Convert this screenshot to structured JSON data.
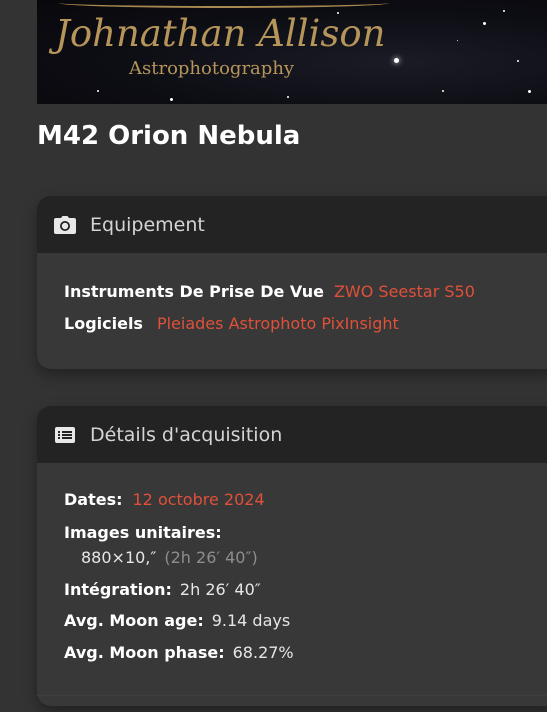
{
  "banner": {
    "name": "Johnathan Allison",
    "subtitle": "Astrophotography"
  },
  "page": {
    "title": "M42 Orion Nebula"
  },
  "equipment": {
    "icon": "camera-icon",
    "title": "Equipement",
    "instruments_label": "Instruments De Prise De Vue",
    "instruments_value": "ZWO Seestar S50",
    "software_label": "Logiciels",
    "software_values": [
      "Pleiades Astrophoto PixInsight"
    ]
  },
  "acquisition": {
    "icon": "list-icon",
    "title": "Détails d'acquisition",
    "dates_label": "Dates:",
    "dates_value": "12 octobre 2024",
    "frames_label": "Images unitaires:",
    "frames_value": "880×10,″",
    "frames_total": "(2h 26′ 40″)",
    "integration_label": "Intégration:",
    "integration_value": "2h 26′ 40″",
    "moon_age_label": "Avg. Moon age:",
    "moon_age_value": "9.14 days",
    "moon_phase_label": "Avg. Moon phase:",
    "moon_phase_value": "68.27%"
  },
  "colors": {
    "accent": "#e0503a",
    "header_bg": "#232323",
    "card_bg": "#383838",
    "page_bg": "#333333",
    "banner_gold": "#b6955a"
  }
}
